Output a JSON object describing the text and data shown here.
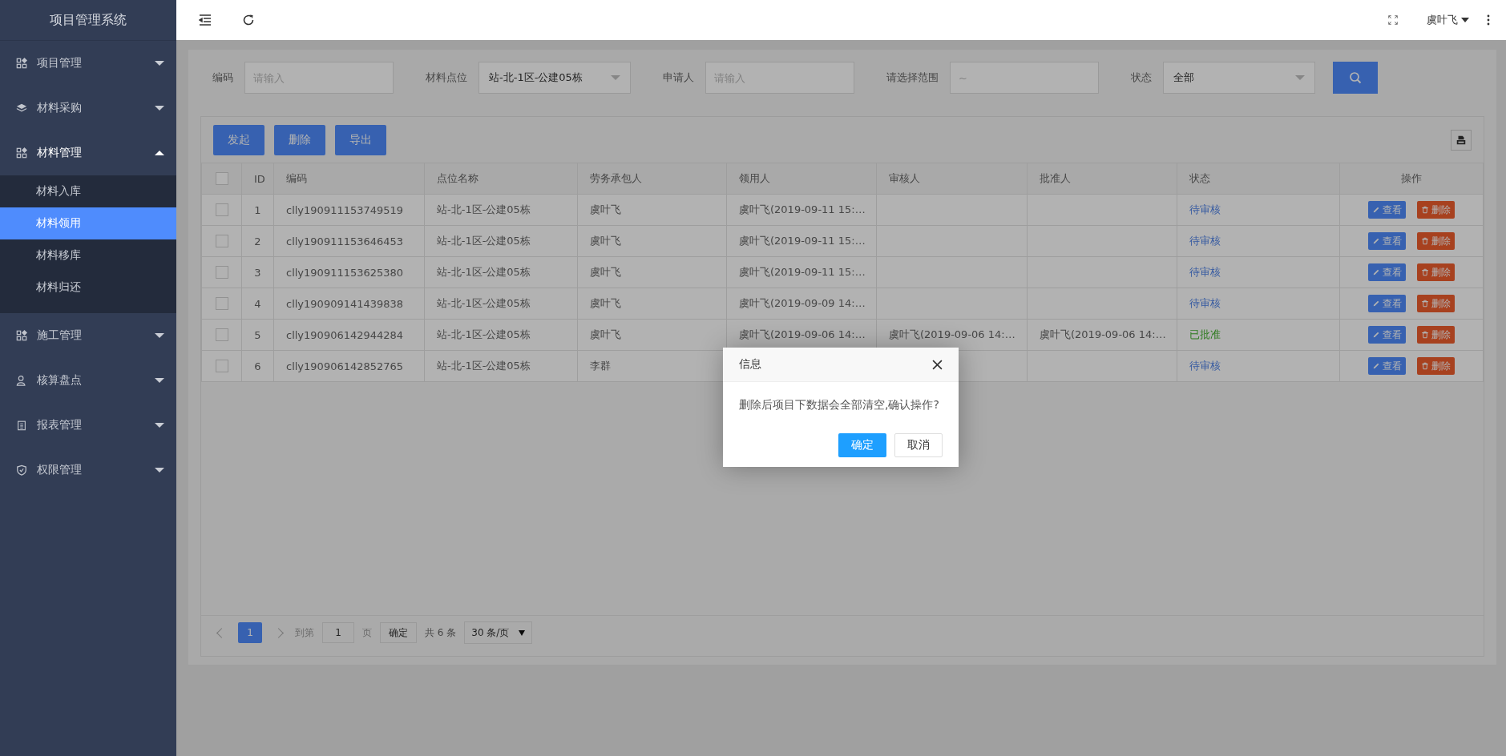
{
  "sidebar": {
    "title": "项目管理系统",
    "items": [
      {
        "label": "项目管理",
        "expanded": false
      },
      {
        "label": "材料采购",
        "expanded": false
      },
      {
        "label": "材料管理",
        "expanded": true,
        "children": [
          {
            "label": "材料入库",
            "selected": false
          },
          {
            "label": "材料领用",
            "selected": true
          },
          {
            "label": "材料移库",
            "selected": false
          },
          {
            "label": "材料归还",
            "selected": false
          }
        ]
      },
      {
        "label": "施工管理",
        "expanded": false
      },
      {
        "label": "核算盘点",
        "expanded": false
      },
      {
        "label": "报表管理",
        "expanded": false
      },
      {
        "label": "权限管理",
        "expanded": false
      }
    ]
  },
  "header": {
    "user": "虞叶飞"
  },
  "filters": [
    {
      "kind": "input",
      "label": "编码",
      "placeholder": "请输入"
    },
    {
      "kind": "select",
      "label": "材料点位",
      "value": "站-北-1区-公建05栋"
    },
    {
      "kind": "input",
      "label": "申请人",
      "placeholder": "请输入"
    },
    {
      "kind": "input",
      "label": "请选择范围",
      "placeholder": "~"
    },
    {
      "kind": "select",
      "label": "状态",
      "value": "全部"
    }
  ],
  "toolbar": {
    "buttons": [
      "发起",
      "删除",
      "导出"
    ]
  },
  "table": {
    "columns": [
      "ID",
      "编码",
      "点位名称",
      "劳务承包人",
      "领用人",
      "审核人",
      "批准人",
      "状态",
      "操作"
    ],
    "header_checked": false,
    "rows": [
      {
        "checked": false,
        "id": "1",
        "code": "clly190911153749519",
        "site": "站-北-1区-公建05栋",
        "contractor": "虞叶飞",
        "receiver": "虞叶飞(2019-09-11 15:…",
        "reviewer": "",
        "approver": "",
        "status": "待审核",
        "color": "#3459a1",
        "actions": [
          "查看",
          "删除"
        ]
      },
      {
        "checked": false,
        "id": "2",
        "code": "clly190911153646453",
        "site": "站-北-1区-公建05栋",
        "contractor": "虞叶飞",
        "receiver": "虞叶飞(2019-09-11 15:…",
        "reviewer": "",
        "approver": "",
        "status": "待审核",
        "color": "#3459a1",
        "actions": [
          "查看",
          "删除"
        ]
      },
      {
        "checked": false,
        "id": "3",
        "code": "clly190911153625380",
        "site": "站-北-1区-公建05栋",
        "contractor": "虞叶飞",
        "receiver": "虞叶飞(2019-09-11 15:…",
        "reviewer": "",
        "approver": "",
        "status": "待审核",
        "color": "#3459a1",
        "actions": [
          "查看",
          "删除"
        ]
      },
      {
        "checked": false,
        "id": "4",
        "code": "clly190909141439838",
        "site": "站-北-1区-公建05栋",
        "contractor": "虞叶飞",
        "receiver": "虞叶飞(2019-09-09 14:…",
        "reviewer": "",
        "approver": "",
        "status": "待审核",
        "color": "#3459a1",
        "actions": [
          "查看",
          "删除"
        ]
      },
      {
        "checked": false,
        "id": "5",
        "code": "clly190906142944284",
        "site": "站-北-1区-公建05栋",
        "contractor": "虞叶飞",
        "receiver": "虞叶飞(2019-09-06 14:…",
        "reviewer": "虞叶飞(2019-09-06 14:…",
        "approver": "虞叶飞(2019-09-06 14:…",
        "status": "已批准",
        "color": "#2c7a1d",
        "actions": [
          "查看",
          "删除"
        ]
      },
      {
        "checked": false,
        "id": "6",
        "code": "clly190906142852765",
        "site": "站-北-1区-公建05栋",
        "contractor": "李群",
        "receiver": "",
        "reviewer": "",
        "approver": "",
        "status": "待审核",
        "color": "#3459a1",
        "actions": [
          "查看",
          "删除"
        ]
      }
    ]
  },
  "pagination": {
    "pages": [
      {
        "label": "1",
        "selected": true
      }
    ],
    "goto_label": "到第",
    "goto_value": "1",
    "page_unit": "页",
    "confirm": "确定",
    "total": "共 6 条",
    "page_size": "30 条/页"
  },
  "dialog": {
    "title": "信息",
    "message": "删除后项目下数据会全部清空,确认操作?",
    "ok": "确定",
    "cancel": "取消"
  }
}
